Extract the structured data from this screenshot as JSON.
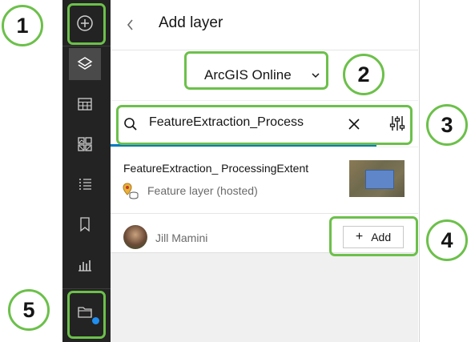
{
  "panel": {
    "title": "Add layer",
    "source_select": {
      "value": "ArcGIS Online"
    },
    "search": {
      "value": "FeatureExtraction_Process"
    },
    "result": {
      "title": "FeatureExtraction_ ProcessingExtent",
      "type": "Feature layer (hosted)",
      "owner": "Jill Mamini",
      "add_label": "Add"
    }
  },
  "callouts": [
    "1",
    "2",
    "3",
    "4",
    "5"
  ],
  "colors": {
    "callout_green": "#6cc04a",
    "accent_blue": "#007ac2",
    "rail_bg": "#232323",
    "badge": "#1f8ef1"
  },
  "rail": {
    "items": [
      {
        "icon": "add-circle-icon"
      },
      {
        "icon": "layers-icon"
      },
      {
        "icon": "table-icon"
      },
      {
        "icon": "basemap-gallery-icon"
      },
      {
        "icon": "legend-list-icon"
      },
      {
        "icon": "bookmark-icon"
      },
      {
        "icon": "chart-icon"
      },
      {
        "icon": "folder-icon"
      }
    ]
  }
}
